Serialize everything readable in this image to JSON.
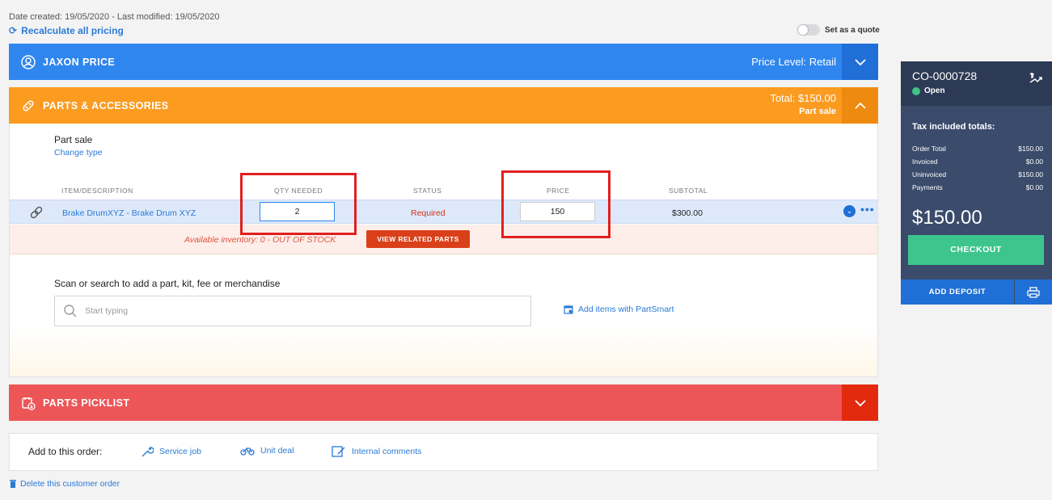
{
  "meta": {
    "dates": "Date created: 19/05/2020 - Last modified: 19/05/2020",
    "recalculate": "Recalculate all pricing",
    "set_quote": "Set as a quote"
  },
  "customer_bar": {
    "name": "JAXON PRICE",
    "price_level": "Price Level: Retail",
    "icon": "user-circle-icon",
    "toggle_icon": "chevron-down-icon",
    "color": "#2f86ee"
  },
  "parts_bar": {
    "title": "PARTS & ACCESSORIES",
    "total": "Total: $150.00",
    "sale_type": "Part sale",
    "icon": "parts-icon",
    "toggle_icon": "chevron-up-icon",
    "color": "#fb9b20"
  },
  "part_sale": {
    "title": "Part sale",
    "change_type": "Change type",
    "columns": {
      "item": "ITEM/DESCRIPTION",
      "qty": "QTY NEEDED",
      "status": "STATUS",
      "price": "PRICE",
      "subtotal": "SUBTOTAL"
    },
    "rows": [
      {
        "description": "Brake DrumXYZ - Brake Drum XYZ",
        "qty": "2",
        "status": "Required",
        "price": "150",
        "subtotal": "$300.00"
      }
    ],
    "availability": "Available inventory: 0 - OUT OF STOCK",
    "view_related": "VIEW RELATED PARTS",
    "scan_label": "Scan or search to add a part, kit, fee or merchandise",
    "search_placeholder": "Start typing",
    "partsmart": "Add items with PartSmart"
  },
  "picklist_bar": {
    "title": "PARTS PICKLIST",
    "icon": "picklist-icon",
    "toggle_icon": "chevron-down-icon",
    "color": "#ed5657"
  },
  "add_to_order": {
    "label": "Add to this order:",
    "options": [
      "Service job",
      "Unit deal",
      "Internal comments"
    ]
  },
  "delete_label": "Delete this customer order",
  "sidebar": {
    "order_id": "CO-0000728",
    "status": "Open",
    "tax_title": "Tax included totals:",
    "totals": [
      {
        "label": "Order Total",
        "value": "$150.00"
      },
      {
        "label": "Invoiced",
        "value": "$0.00"
      },
      {
        "label": "Uninvoiced",
        "value": "$150.00"
      },
      {
        "label": "Payments",
        "value": "$0.00"
      }
    ],
    "big_total": "$150.00",
    "checkout": "CHECKOUT",
    "add_deposit": "ADD DEPOSIT",
    "status_color": "#3ec584"
  }
}
